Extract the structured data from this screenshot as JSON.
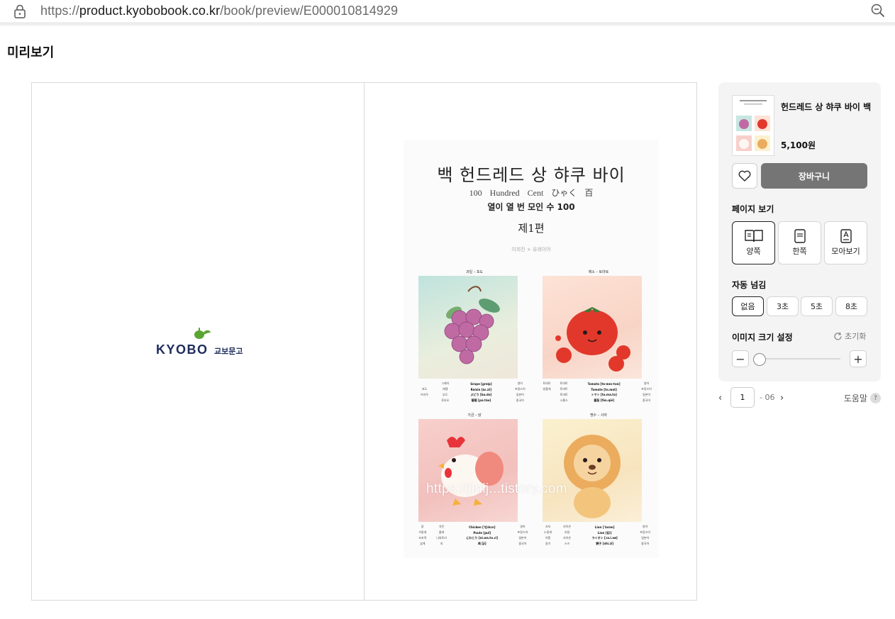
{
  "browser": {
    "url_scheme": "https://",
    "url_host": "product.kyobobook.co.kr",
    "url_path": "/book/preview/E000010814929"
  },
  "page": {
    "title": "미리보기"
  },
  "viewer": {
    "left_logo": {
      "brand": "KYOBO",
      "brand_ko": "교보문고"
    },
    "book": {
      "title": "백 헌드레드 상 햐쿠 바이",
      "subtitle": "100 Hundred Cent ひゃく 百",
      "subtitle2": "열이 열 번 모인 수 100",
      "volume": "제1편",
      "author": "이희진 × 유레이어",
      "cards": [
        {
          "caption": "과일 – 포도",
          "rows": [
            [
              "",
              "그레이",
              "Grape [greip]",
              "영어"
            ],
            [
              "포도",
              "레젱",
              "Raisin [ʀɛ.zɛ̃]",
              "프랑스어"
            ],
            [
              "브라우",
              "부도",
              "ぶどう [bu.do]",
              "일본어"
            ],
            [
              "",
              "푸타오",
              "葡萄 [pú.táo]",
              "중국어"
            ]
          ]
        },
        {
          "caption": "채소 – 토마토",
          "rows": [
            [
              "토마토",
              "토마토",
              "Tomato [tə·meɪ·toʊ]",
              "영어"
            ],
            [
              "방울게",
              "토마트",
              "Tomate [to.mat]",
              "프랑스어"
            ],
            [
              "",
              "토마토",
              "トマト [to.ma.to]",
              "일본어"
            ],
            [
              "",
              "시홍스",
              "番茄 [fān.qié]",
              "중국어"
            ]
          ]
        },
        {
          "caption": "가금 – 닭",
          "rows": [
            [
              "닭",
              "치킨",
              "Chicken [ˈtʃɪkɪn]",
              "영어"
            ],
            [
              "수탉게",
              "풀레",
              "Poule [pul]",
              "프랑스어"
            ],
            [
              "꼬꼬댁",
              "니와토리",
              "にわとり [ni.wa.to.ɾi]",
              "일본어"
            ],
            [
              "삼계",
              "지",
              "鸡 [jī]",
              "중국어"
            ]
          ]
        },
        {
          "caption": "맹수 – 사자",
          "rows": [
            [
              "사자",
              "라이온",
              "Lion [ˈlaɪən]",
              "영어"
            ],
            [
              "누렁게",
              "리용",
              "Lion [ljɔ̃]",
              "프랑스어"
            ],
            [
              "어흥",
              "라이온",
              "ライオン [ɾa.i.oɴ]",
              "일본어"
            ],
            [
              "갈기",
              "스즈",
              "狮子 [shī.zi]",
              "중국어"
            ]
          ]
        }
      ],
      "watermark": "https://jinij...tistory.com"
    }
  },
  "sidebar": {
    "product": {
      "title": "헌드레드 상 햐쿠 바이 백",
      "price": "5,100원"
    },
    "cart_label": "장바구니",
    "page_view": {
      "label": "페이지 보기",
      "options": [
        {
          "label": "양쪽",
          "icon": "open-book-icon",
          "active": true
        },
        {
          "label": "한쪽",
          "icon": "single-page-icon",
          "active": false
        },
        {
          "label": "모아보기",
          "icon": "grid-pages-icon",
          "active": false
        }
      ]
    },
    "auto_flip": {
      "label": "자동 넘김",
      "options": [
        {
          "label": "없음",
          "active": true
        },
        {
          "label": "3초",
          "active": false
        },
        {
          "label": "5초",
          "active": false
        },
        {
          "label": "8초",
          "active": false
        }
      ]
    },
    "image_size": {
      "label": "이미지 크기 설정",
      "reset_label": "초기화",
      "level": 0
    }
  },
  "pager": {
    "current": "1",
    "total": "- 06",
    "help_label": "도움말",
    "help_mark": "?"
  },
  "colors": {
    "kyobo_navy": "#1d2c5c",
    "kyobo_green": "#5aa532",
    "cart_bg": "#757575",
    "sidebar_bg": "#f4f4f4"
  }
}
